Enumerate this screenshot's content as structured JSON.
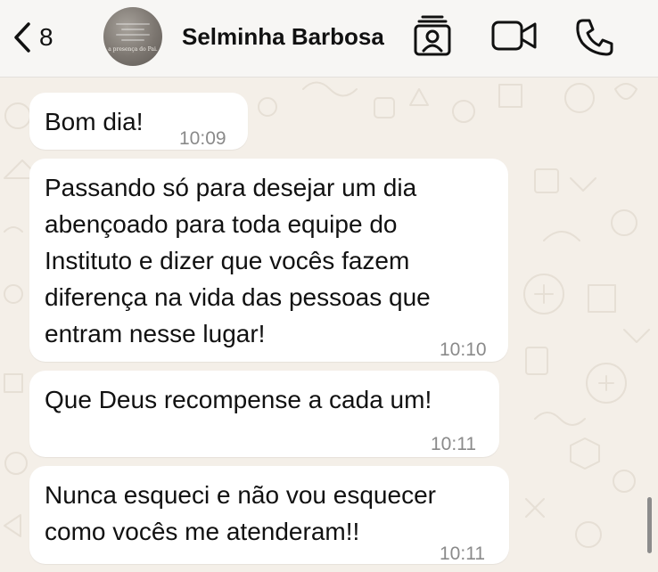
{
  "header": {
    "back_count": "8",
    "contact_name": "Selminha Barbosa",
    "avatar_caption": "a presença do Pai.",
    "icons": [
      "chevron-left-icon",
      "contact-card-icon",
      "video-camera-icon",
      "phone-icon"
    ]
  },
  "messages": [
    {
      "text": "Bom dia!",
      "time": "10:09"
    },
    {
      "text": "Passando só para desejar um dia\nabençoado para toda equipe do\nInstituto e dizer que vocês fazem\ndiferença na vida das pessoas que\nentram nesse lugar!",
      "time": "10:10"
    },
    {
      "text": "Que Deus recompense a cada um!",
      "time": "10:11"
    },
    {
      "text": "Nunca esqueci e não vou esquecer\ncomo vocês me atenderam!!",
      "time": "10:11"
    }
  ],
  "colors": {
    "chat_background": "#f4efe8",
    "bubble": "#ffffff",
    "timestamp": "#8a8a8a",
    "header_background": "#f7f6f4"
  }
}
